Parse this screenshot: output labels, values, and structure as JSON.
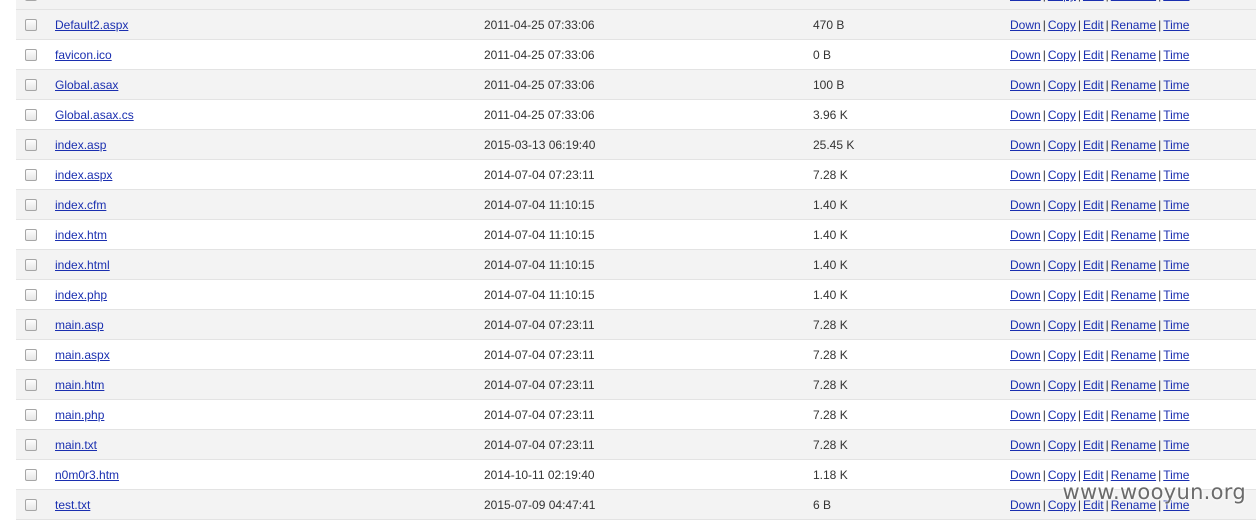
{
  "actions": {
    "down": "Down",
    "copy": "Copy",
    "edit": "Edit",
    "rename": "Rename",
    "time": "Time",
    "separator": "|"
  },
  "files": [
    {
      "name": "",
      "modified": "",
      "size": ""
    },
    {
      "name": "Default2.aspx",
      "modified": "2011-04-25 07:33:06",
      "size": "470 B"
    },
    {
      "name": "favicon.ico",
      "modified": "2011-04-25 07:33:06",
      "size": "0 B"
    },
    {
      "name": "Global.asax",
      "modified": "2011-04-25 07:33:06",
      "size": "100 B"
    },
    {
      "name": "Global.asax.cs",
      "modified": "2011-04-25 07:33:06",
      "size": "3.96 K"
    },
    {
      "name": "index.asp",
      "modified": "2015-03-13 06:19:40",
      "size": "25.45 K"
    },
    {
      "name": "index.aspx",
      "modified": "2014-07-04 07:23:11",
      "size": "7.28 K"
    },
    {
      "name": "index.cfm",
      "modified": "2014-07-04 11:10:15",
      "size": "1.40 K"
    },
    {
      "name": "index.htm",
      "modified": "2014-07-04 11:10:15",
      "size": "1.40 K"
    },
    {
      "name": "index.html",
      "modified": "2014-07-04 11:10:15",
      "size": "1.40 K"
    },
    {
      "name": "index.php",
      "modified": "2014-07-04 11:10:15",
      "size": "1.40 K"
    },
    {
      "name": "main.asp",
      "modified": "2014-07-04 07:23:11",
      "size": "7.28 K"
    },
    {
      "name": "main.aspx",
      "modified": "2014-07-04 07:23:11",
      "size": "7.28 K"
    },
    {
      "name": "main.htm",
      "modified": "2014-07-04 07:23:11",
      "size": "7.28 K"
    },
    {
      "name": "main.php",
      "modified": "2014-07-04 07:23:11",
      "size": "7.28 K"
    },
    {
      "name": "main.txt",
      "modified": "2014-07-04 07:23:11",
      "size": "7.28 K"
    },
    {
      "name": "n0m0r3.htm",
      "modified": "2014-10-11 02:19:40",
      "size": "1.18 K"
    },
    {
      "name": "test.txt",
      "modified": "2015-07-09 04:47:41",
      "size": "6 B"
    }
  ],
  "watermark": "www.wooyun.org",
  "colors": {
    "link": "#1a2fb0",
    "row_alt": "#f3f3f3",
    "row_border": "#e3e3e3",
    "text": "#333333"
  }
}
